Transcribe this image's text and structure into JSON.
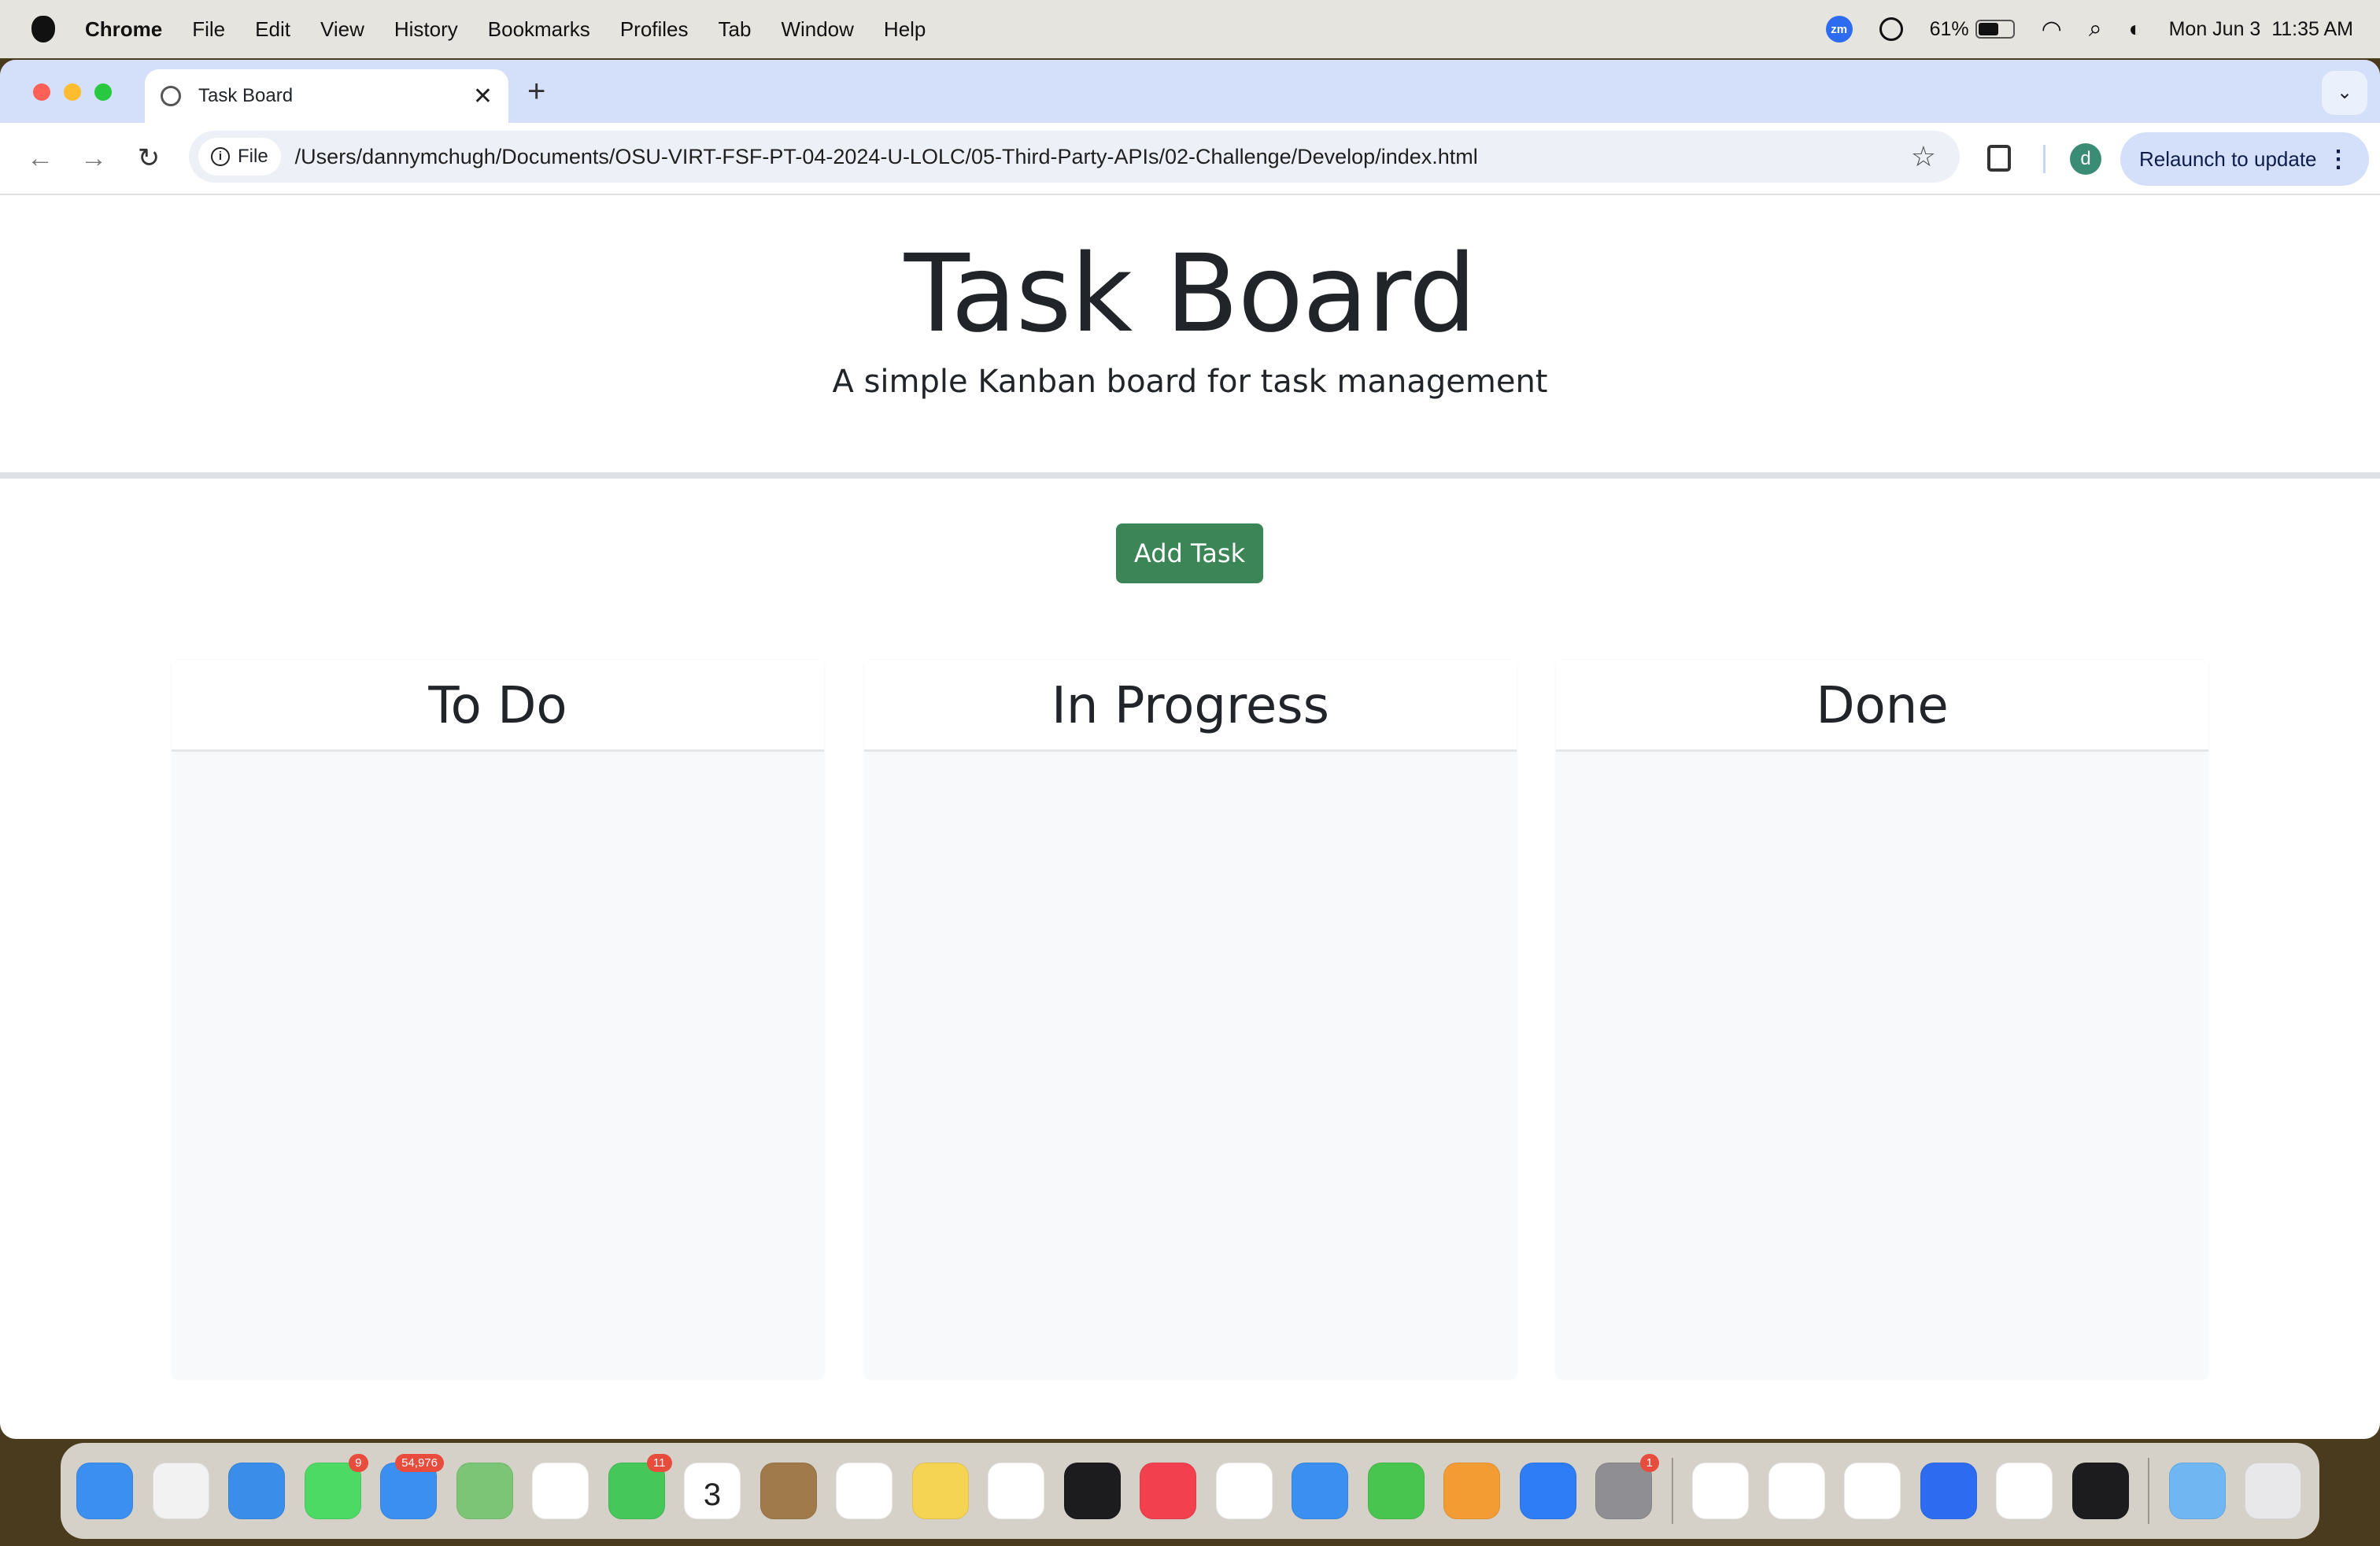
{
  "menubar": {
    "app": "Chrome",
    "items": [
      "File",
      "Edit",
      "View",
      "History",
      "Bookmarks",
      "Profiles",
      "Tab",
      "Window",
      "Help"
    ],
    "zoom_icon_text": "zm",
    "battery": "61%",
    "battery_level": 0.61,
    "datetime": "Mon Jun 3  11:35 AM"
  },
  "browser": {
    "tab_title": "Task Board",
    "omnibox_chip": "File",
    "url": "/Users/dannymchugh/Documents/OSU-VIRT-FSF-PT-04-2024-U-LOLC/05-Third-Party-APIs/02-Challenge/Develop/index.html",
    "avatar": "d",
    "relaunch": "Relaunch to update"
  },
  "page": {
    "title": "Task Board",
    "subtitle": "A simple Kanban board for task management",
    "add_button": "Add Task",
    "columns": [
      {
        "title": "To Do"
      },
      {
        "title": "In Progress"
      },
      {
        "title": "Done"
      }
    ]
  },
  "dock": {
    "apps": [
      {
        "name": "finder",
        "color": "#3b8ff0"
      },
      {
        "name": "launchpad",
        "color": "#f2f2f2"
      },
      {
        "name": "safari",
        "color": "#3a8de8"
      },
      {
        "name": "messages",
        "color": "#4cd964",
        "badge": "9"
      },
      {
        "name": "mail",
        "color": "#3a8ff0",
        "badge": "54,976"
      },
      {
        "name": "maps",
        "color": "#7cc576"
      },
      {
        "name": "photos",
        "color": "#ffffff"
      },
      {
        "name": "facetime",
        "color": "#45c75a",
        "badge": "11"
      },
      {
        "name": "calendar",
        "color": "#ffffff",
        "text": "3"
      },
      {
        "name": "contacts",
        "color": "#a07a4a"
      },
      {
        "name": "reminders",
        "color": "#ffffff"
      },
      {
        "name": "notes",
        "color": "#f5d453"
      },
      {
        "name": "freeform",
        "color": "#ffffff"
      },
      {
        "name": "apple-tv",
        "color": "#1c1c1e"
      },
      {
        "name": "music",
        "color": "#f2404f"
      },
      {
        "name": "news",
        "color": "#ffffff"
      },
      {
        "name": "keynote",
        "color": "#3a8ff0"
      },
      {
        "name": "numbers",
        "color": "#48c54f"
      },
      {
        "name": "pages",
        "color": "#f39c33"
      },
      {
        "name": "app-store",
        "color": "#2e7cf6"
      },
      {
        "name": "system-settings",
        "color": "#8e8e93",
        "badge": "1"
      },
      {
        "sep": true
      },
      {
        "name": "slack",
        "color": "#ffffff"
      },
      {
        "name": "chrome-dev",
        "color": "#ffffff"
      },
      {
        "name": "chrome",
        "color": "#ffffff"
      },
      {
        "name": "zoom",
        "color": "#2d6cf0"
      },
      {
        "name": "vscode",
        "color": "#ffffff"
      },
      {
        "name": "terminal",
        "color": "#1c1c1e"
      },
      {
        "sep": true
      },
      {
        "name": "downloads-folder",
        "color": "#6fb6f2"
      },
      {
        "name": "trash",
        "color": "#e8e8ea"
      }
    ]
  }
}
